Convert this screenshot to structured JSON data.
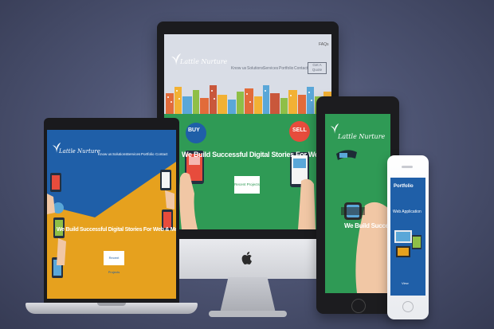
{
  "colors": {
    "brand_green": "#2f9a55",
    "hero_orange": "#e6a11e",
    "accent_blue": "#1f5fa8",
    "nav_bg": "#d9dde6"
  },
  "imac": {
    "faq_label": "FAQs",
    "logo_text": "Lattle Nurture",
    "nav": [
      "Know us",
      "Solutions",
      "Services",
      "Portfolio",
      "Contact"
    ],
    "quote_button": "Get A Quote",
    "buy_badge": "BUY",
    "sell_badge": "SELL",
    "headline": "We Build Successful Digital Stories For Web & Mobile",
    "recent_button": "Recent Projects"
  },
  "laptop": {
    "logo_text": "Lattle Nurture",
    "nav": [
      "Know us",
      "Solutions",
      "Services",
      "Portfolio",
      "Contact"
    ],
    "headline": "We Build Successful Digital Stories For Web & Mobile",
    "recent_button": "Recent Projects"
  },
  "tablet": {
    "logo_text": "Lattle Nurture",
    "headline": "We Build Succes"
  },
  "phone": {
    "title": "Portfolio",
    "subtitle": "Web Application",
    "view_button": "View"
  },
  "icons": [
    "apple-logo-icon",
    "leaf-logo-icon",
    "smartphone-icon",
    "smartwatch-icon"
  ]
}
